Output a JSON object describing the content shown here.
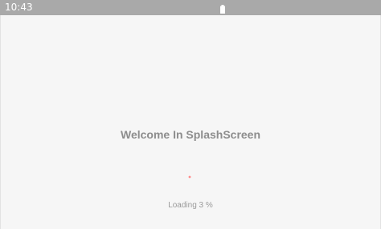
{
  "status_bar": {
    "time": "10:43",
    "battery_icon": "battery-icon",
    "background_color": "#a9a9a9"
  },
  "splash": {
    "title": "Welcome In SplashScreen",
    "progress_icon": "progress-spinner-icon",
    "progress_color": "#ff8a8a",
    "loading_text": "Loading 3 %",
    "progress_percent": 3
  }
}
